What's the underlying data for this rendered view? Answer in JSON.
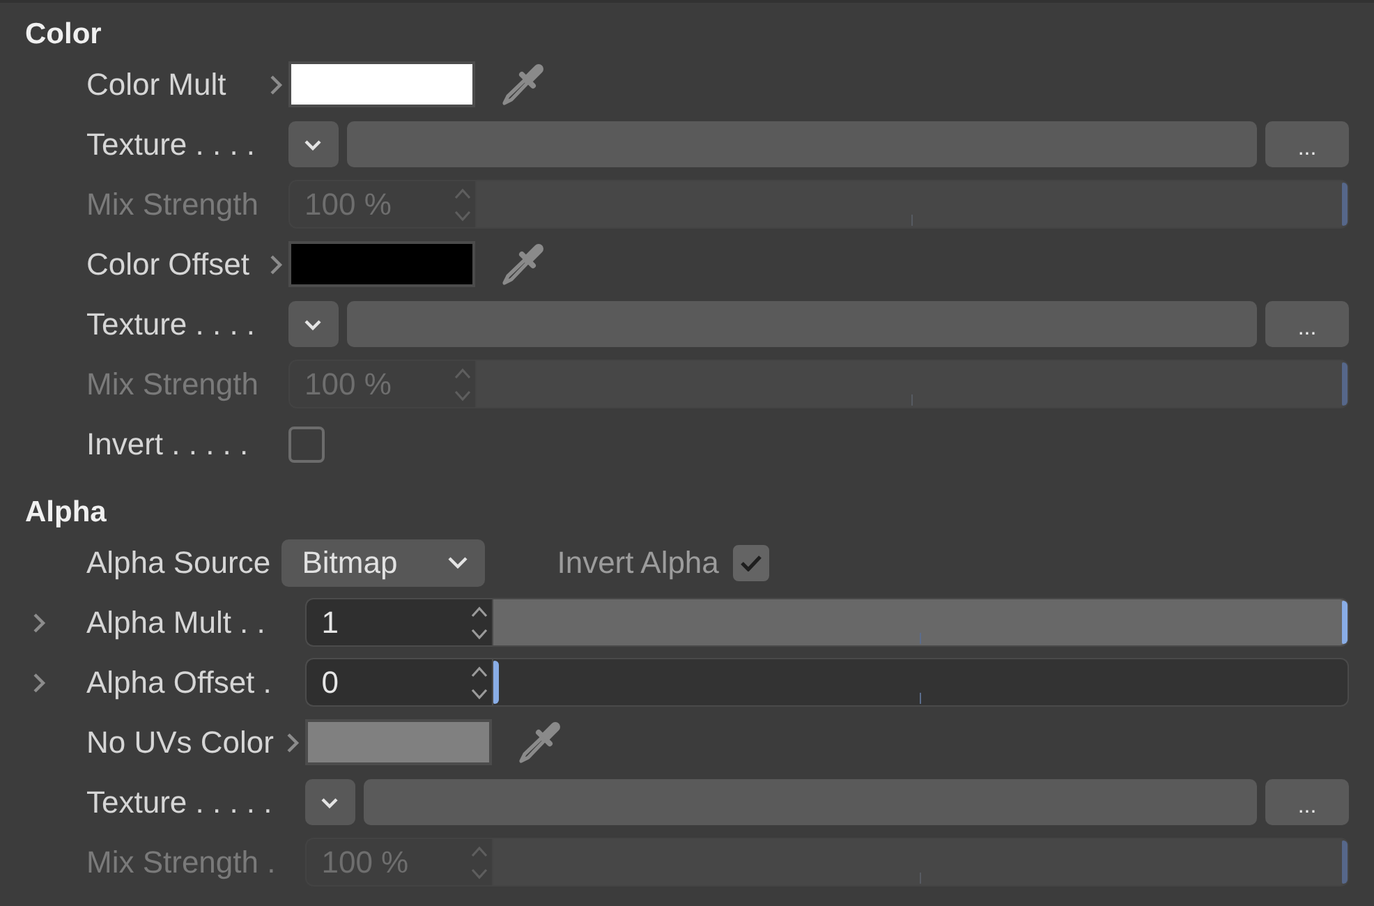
{
  "sections": [
    {
      "title": "Color",
      "rows": [
        {
          "kind": "color",
          "label": "Color Mult",
          "disabled": false,
          "expanded": false,
          "color": "#ffffff"
        },
        {
          "kind": "texture",
          "label": "Texture . . . .",
          "disabled": false,
          "button": "..."
        },
        {
          "kind": "slider",
          "label": "Mix Strength",
          "disabled": true,
          "value": "100 %",
          "level": 1
        },
        {
          "kind": "color",
          "label": "Color Offset",
          "disabled": false,
          "expanded": false,
          "color": "#000000"
        },
        {
          "kind": "texture",
          "label": "Texture . . . .",
          "disabled": false,
          "button": "..."
        },
        {
          "kind": "slider",
          "label": "Mix Strength",
          "disabled": true,
          "value": "100 %",
          "level": 1
        },
        {
          "kind": "checkbox",
          "label": "Invert . . . . .",
          "disabled": false,
          "checked": false
        }
      ]
    },
    {
      "title": "Alpha",
      "rows": [
        {
          "kind": "dropdown",
          "label": "Alpha Source",
          "disabled": false,
          "value": "Bitmap",
          "option": {
            "label": "Invert Alpha",
            "checked": true
          }
        },
        {
          "kind": "slider",
          "label": "Alpha Mult . .",
          "disabled": false,
          "expanded": false,
          "value": "1",
          "level": 1
        },
        {
          "kind": "slider",
          "label": "Alpha Offset .",
          "disabled": false,
          "expanded": false,
          "value": "0",
          "level": 0
        },
        {
          "kind": "color",
          "label": "No UVs Color",
          "disabled": false,
          "expanded": false,
          "color": "#808080"
        },
        {
          "kind": "texture",
          "label": "Texture . . . . .",
          "disabled": false,
          "button": "..."
        },
        {
          "kind": "slider",
          "label": "Mix Strength .",
          "disabled": true,
          "value": "100 %",
          "level": 1
        }
      ]
    }
  ]
}
